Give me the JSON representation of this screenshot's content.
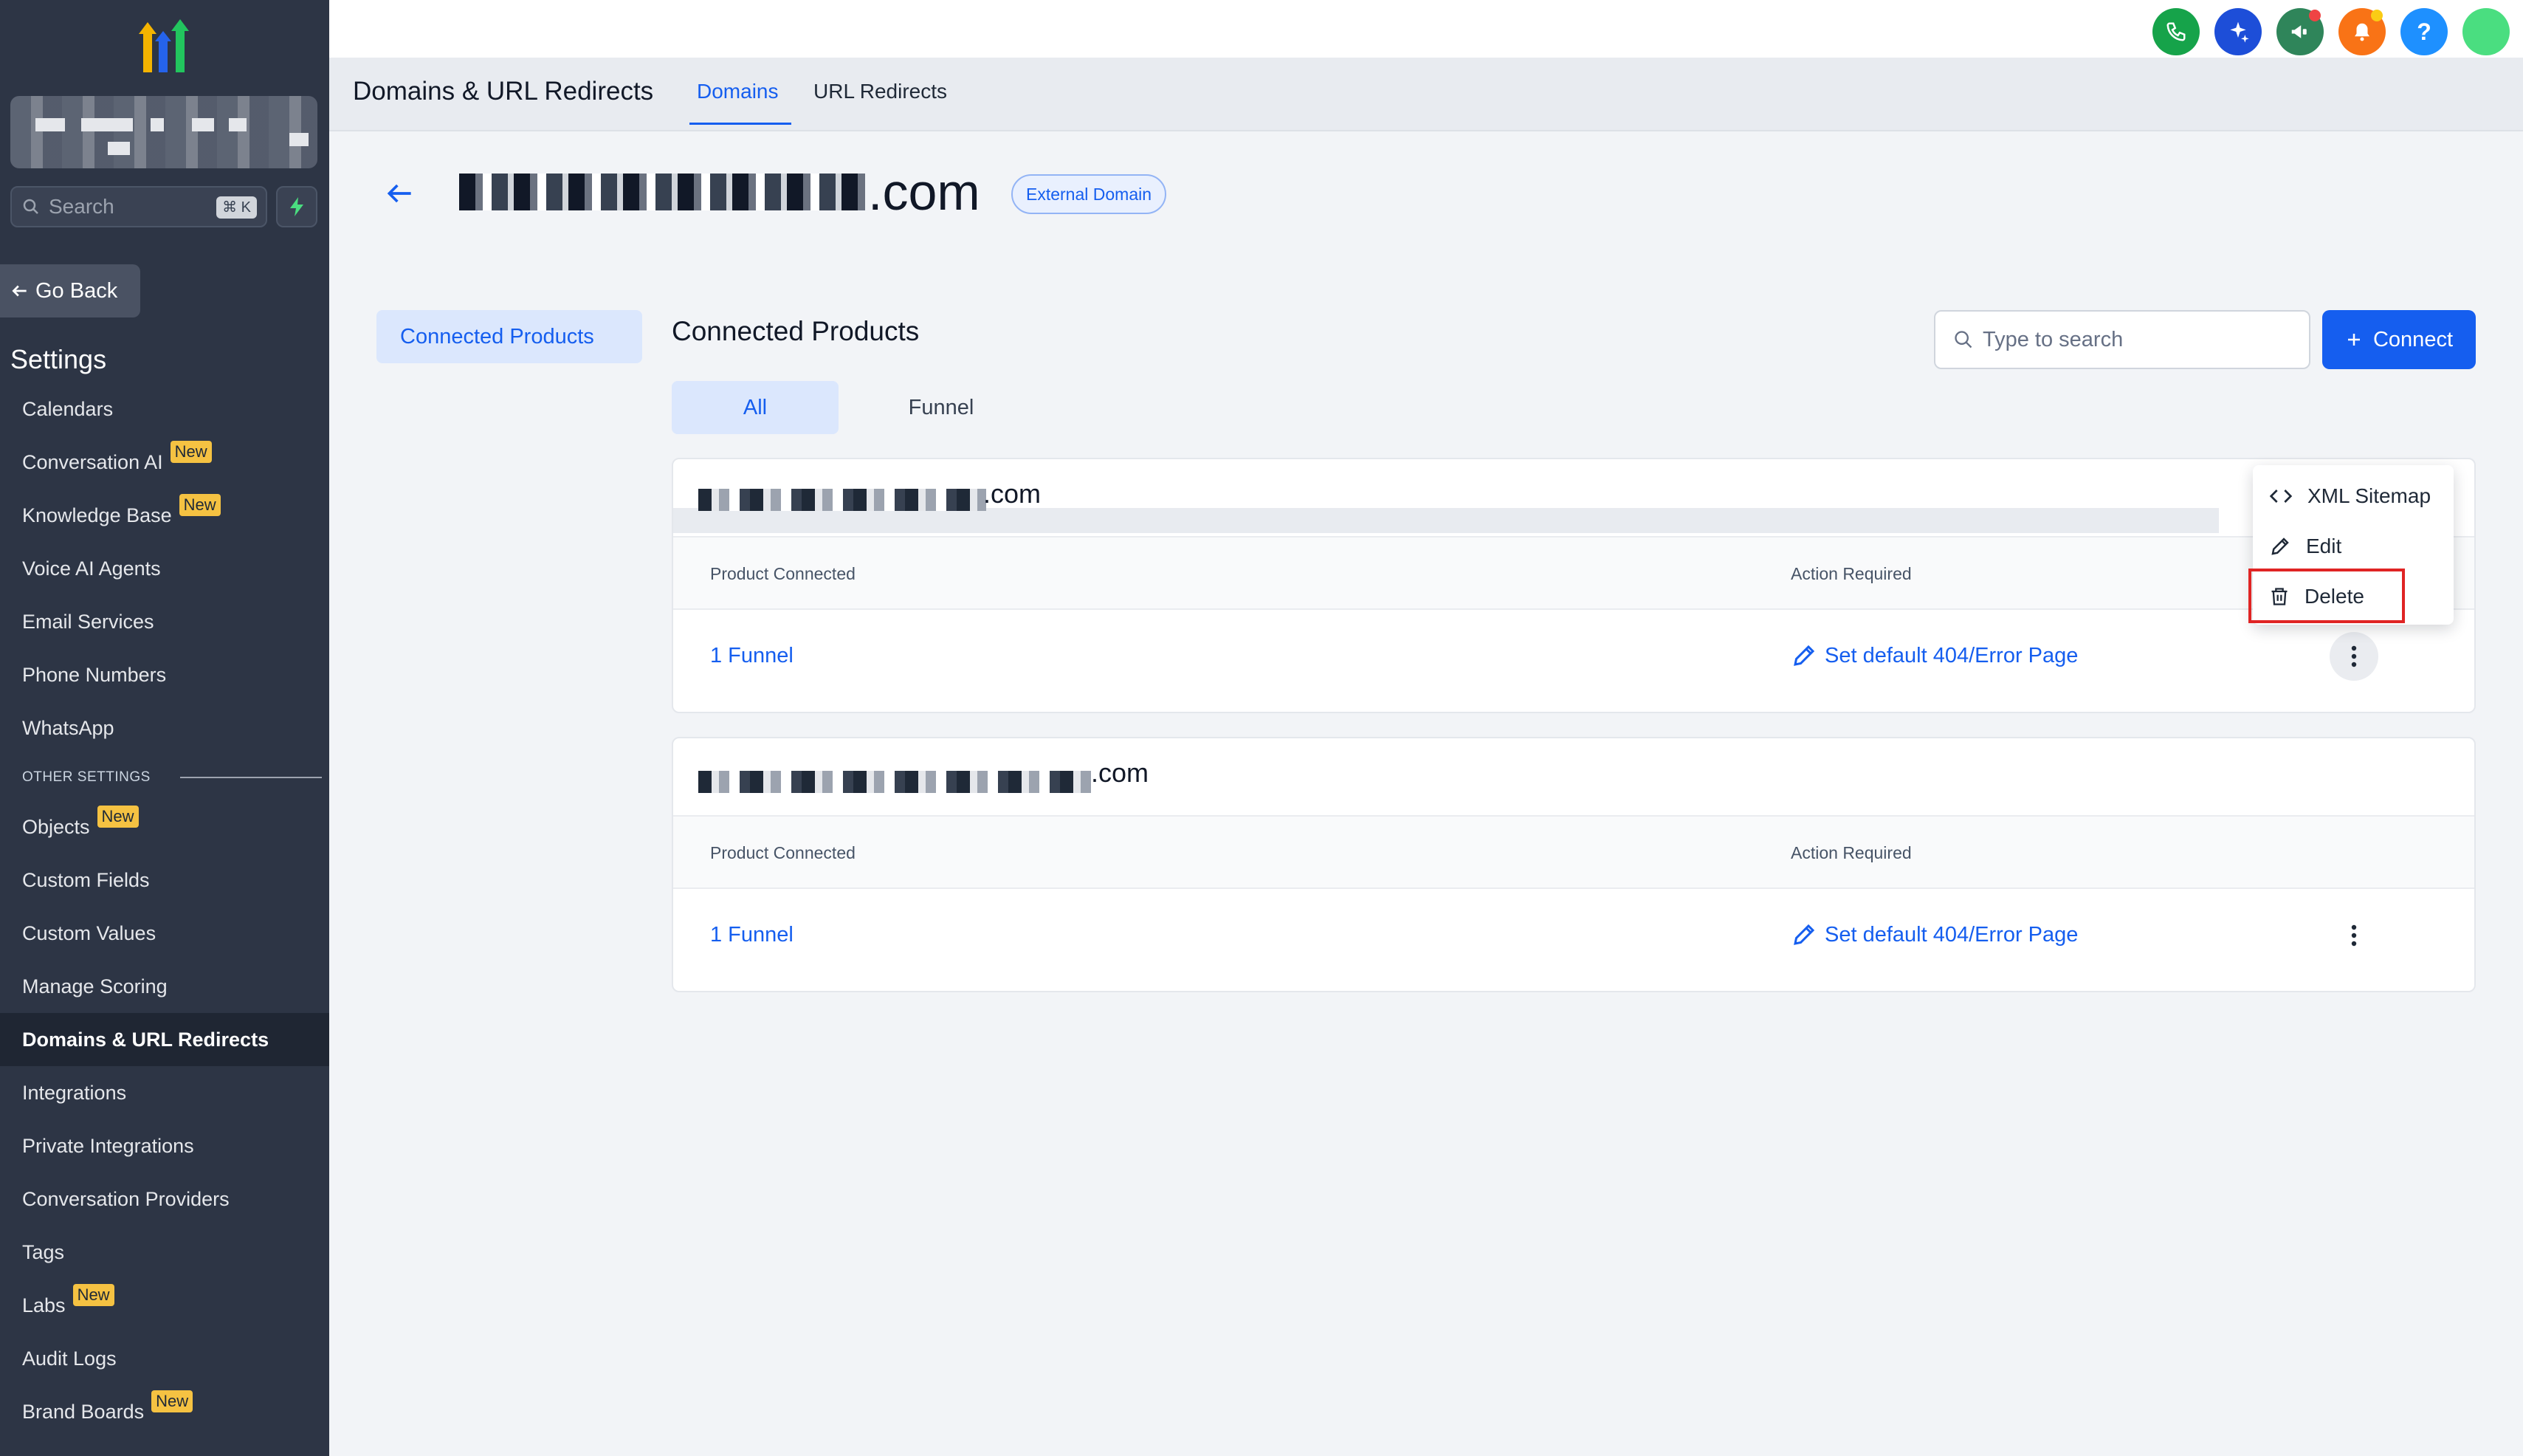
{
  "sidebar": {
    "search_placeholder": "Search",
    "search_shortcut": "⌘ K",
    "go_back": "Go Back",
    "settings_title": "Settings",
    "badge_new": "New",
    "other_settings": "OTHER SETTINGS",
    "items": [
      {
        "label": "Calendars"
      },
      {
        "label": "Conversation AI",
        "badge": "New"
      },
      {
        "label": "Knowledge Base",
        "badge": "New"
      },
      {
        "label": "Voice AI Agents"
      },
      {
        "label": "Email Services"
      },
      {
        "label": "Phone Numbers"
      },
      {
        "label": "WhatsApp"
      }
    ],
    "other_items": [
      {
        "label": "Objects",
        "badge": "New"
      },
      {
        "label": "Custom Fields"
      },
      {
        "label": "Custom Values"
      },
      {
        "label": "Manage Scoring"
      },
      {
        "label": "Domains & URL Redirects",
        "active": true
      },
      {
        "label": "Integrations"
      },
      {
        "label": "Private Integrations"
      },
      {
        "label": "Conversation Providers"
      },
      {
        "label": "Tags"
      },
      {
        "label": "Labs",
        "badge": "New"
      },
      {
        "label": "Audit Logs"
      },
      {
        "label": "Brand Boards",
        "badge": "New"
      }
    ]
  },
  "topbar": {
    "icons": [
      {
        "name": "phone-icon",
        "color": "#16a34a"
      },
      {
        "name": "ai-sparkle-icon",
        "color": "#1d4ed8"
      },
      {
        "name": "megaphone-icon",
        "color": "#2f855a"
      },
      {
        "name": "bell-icon",
        "color": "#f97316"
      },
      {
        "name": "help-icon",
        "color": "#1e90ff"
      },
      {
        "name": "avatar",
        "color": "#4ade80"
      }
    ],
    "help_glyph": "?"
  },
  "header": {
    "title": "Domains & URL Redirects",
    "tabs": [
      {
        "label": "Domains",
        "active": true
      },
      {
        "label": "URL Redirects",
        "active": false
      }
    ]
  },
  "domain": {
    "suffix": ".com",
    "badge": "External Domain"
  },
  "left_menu": {
    "connected_products": "Connected Products"
  },
  "main": {
    "title": "Connected Products",
    "search_placeholder": "Type to search",
    "connect_label": "Connect",
    "filters": [
      {
        "label": "All",
        "active": true
      },
      {
        "label": "Funnel",
        "active": false
      }
    ],
    "table_headers": {
      "product": "Product Connected",
      "action": "Action Required"
    },
    "cards": [
      {
        "domain_suffix": ".com",
        "product": "1 Funnel",
        "action": "Set default 404/Error Page"
      },
      {
        "domain_suffix": ".com",
        "product": "1 Funnel",
        "action": "Set default 404/Error Page"
      }
    ]
  },
  "dropdown": {
    "items": [
      {
        "label": "XML Sitemap",
        "icon": "code-icon"
      },
      {
        "label": "Edit",
        "icon": "pencil-icon"
      },
      {
        "label": "Delete",
        "icon": "trash-icon"
      }
    ]
  },
  "colors": {
    "accent": "#155eef",
    "sidebar_bg": "#2d3545",
    "badge_new": "#f5c242",
    "highlight": "#e02424"
  }
}
